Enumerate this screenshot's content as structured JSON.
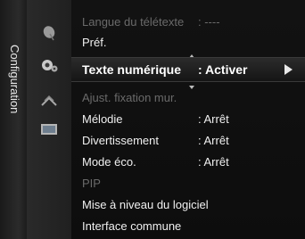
{
  "category": {
    "label": "Configuration"
  },
  "icons": [
    "satellite-dish-icon",
    "gear-icon",
    "signal-antenna-icon",
    "tv-screen-icon"
  ],
  "menu": {
    "items": [
      {
        "label": "Langue du télétexte",
        "value": ": ----",
        "state": "disabled"
      },
      {
        "label": "Préf.",
        "value": "",
        "state": "normal"
      },
      {
        "label": "Texte numérique",
        "value": ": Activer",
        "state": "selected"
      },
      {
        "label": "Ajust. fixation mur.",
        "value": "",
        "state": "disabled"
      },
      {
        "label": "Mélodie",
        "value": ": Arrêt",
        "state": "normal"
      },
      {
        "label": "Divertissement",
        "value": ": Arrêt",
        "state": "normal"
      },
      {
        "label": "Mode éco.",
        "value": ": Arrêt",
        "state": "normal"
      },
      {
        "label": "PIP",
        "value": "",
        "state": "disabled"
      },
      {
        "label": "Mise à niveau du logiciel",
        "value": "",
        "state": "normal"
      },
      {
        "label": "Interface commune",
        "value": "",
        "state": "normal"
      }
    ]
  }
}
